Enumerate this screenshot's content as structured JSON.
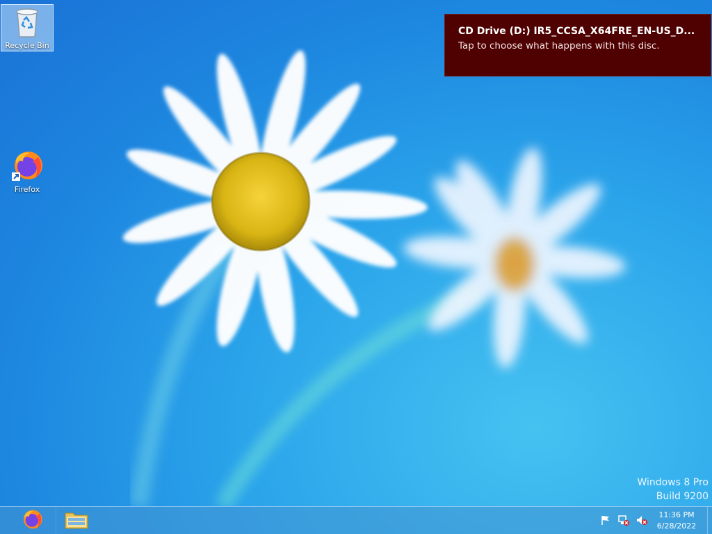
{
  "desktop": {
    "icons": [
      {
        "label": "Recycle Bin",
        "icon": "recycle-bin-icon"
      },
      {
        "label": "Firefox",
        "icon": "firefox-icon"
      }
    ]
  },
  "notification": {
    "title": "CD Drive (D:) IR5_CCSA_X64FRE_EN-US_D...",
    "message": "Tap to choose what happens with this disc.",
    "background": "#4f0000"
  },
  "watermark": {
    "line1": "Windows 8 Pro",
    "line2": "Build 9200"
  },
  "taskbar": {
    "pinned": [
      {
        "name": "Firefox",
        "icon": "firefox-icon"
      },
      {
        "name": "File Explorer",
        "icon": "folder-icon"
      }
    ],
    "tray_icons": [
      "action-center-flag-icon",
      "network-disconnected-icon",
      "volume-muted-icon"
    ],
    "clock": {
      "time": "11:36 PM",
      "date": "6/28/2022"
    }
  }
}
